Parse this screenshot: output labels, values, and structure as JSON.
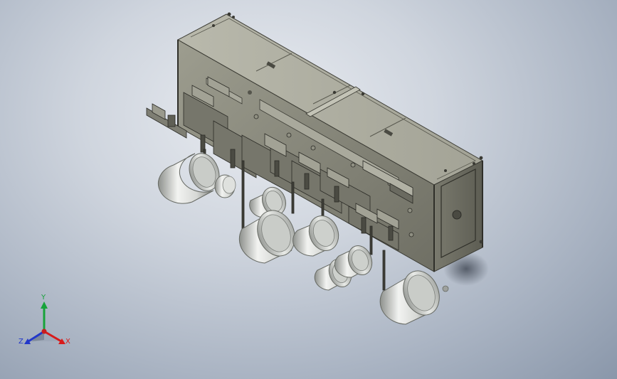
{
  "triad": {
    "y_label": "Y",
    "x_label": "X",
    "z_label": "Z",
    "y_color": "#17a33a",
    "x_color": "#d81b1b",
    "z_color": "#2238c9"
  },
  "colors": {
    "background_center": "#e9ecf1",
    "background_edge": "#8a97aa",
    "frame_face": "#8c8c7e",
    "frame_dark": "#55554c",
    "ring_light": "#eef0ee",
    "ring_shadow": "#7d807c"
  }
}
